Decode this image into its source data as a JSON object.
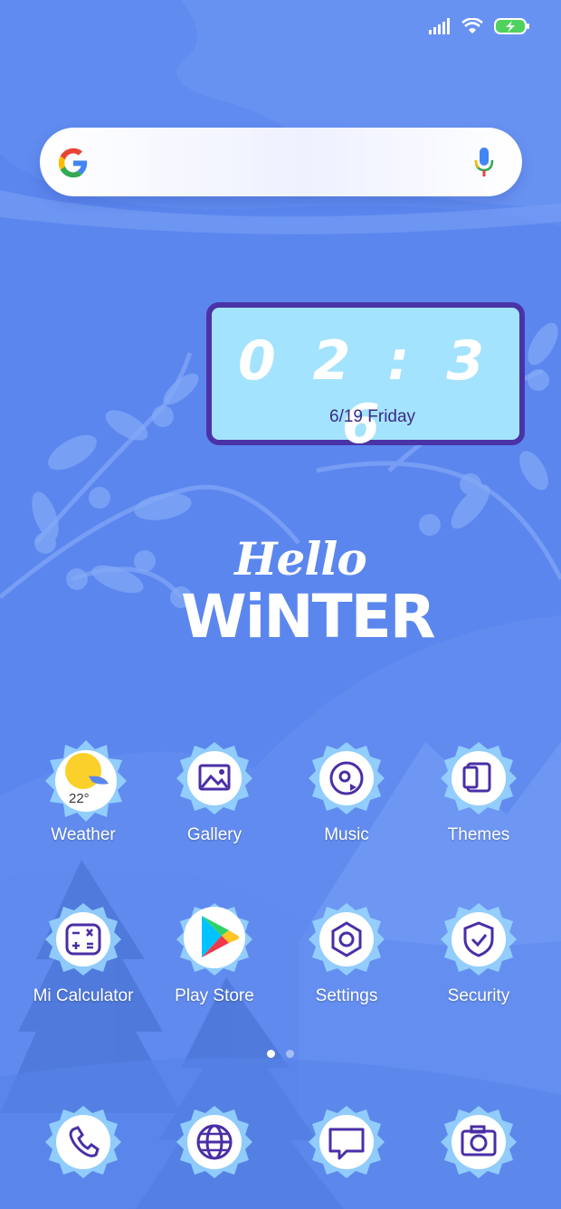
{
  "colors": {
    "background": "#5b86ee",
    "clock_border": "#4a33a6",
    "clock_fill": "#a4e3fd",
    "icon_line": "#4a2ea6"
  },
  "status_bar": {
    "signal": "signal-icon",
    "wifi": "wifi-icon",
    "battery": "battery-charging-icon"
  },
  "search": {
    "logo": "google-logo",
    "mic": "mic-icon"
  },
  "clock": {
    "time": "0 2 : 3 6",
    "date": "6/19 Friday"
  },
  "greeting": {
    "line1": "Hello",
    "line2": "WiNTER"
  },
  "apps_row1": [
    {
      "label": "Weather",
      "icon": "weather-icon",
      "temp": "22°"
    },
    {
      "label": "Gallery",
      "icon": "gallery-icon"
    },
    {
      "label": "Music",
      "icon": "music-icon"
    },
    {
      "label": "Themes",
      "icon": "themes-icon"
    }
  ],
  "apps_row2": [
    {
      "label": "Mi Calculator",
      "icon": "calculator-icon"
    },
    {
      "label": "Play Store",
      "icon": "play-store-icon"
    },
    {
      "label": "Settings",
      "icon": "settings-icon"
    },
    {
      "label": "Security",
      "icon": "security-icon"
    }
  ],
  "dock": [
    {
      "icon": "phone-icon"
    },
    {
      "icon": "browser-icon"
    },
    {
      "icon": "messages-icon"
    },
    {
      "icon": "camera-icon"
    }
  ],
  "pager": {
    "pages": 2,
    "current": 1
  }
}
